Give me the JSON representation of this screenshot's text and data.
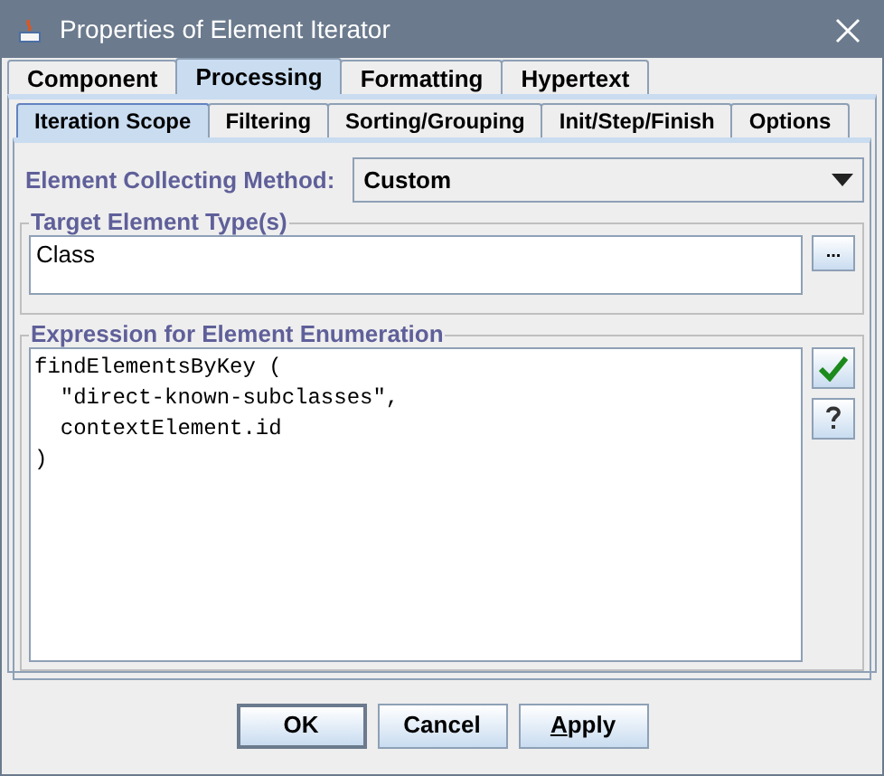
{
  "window": {
    "title": "Properties of Element Iterator"
  },
  "tabs": [
    {
      "label": "Component",
      "selected": false
    },
    {
      "label": "Processing",
      "selected": true
    },
    {
      "label": "Formatting",
      "selected": false
    },
    {
      "label": "Hypertext",
      "selected": false
    }
  ],
  "subtabs": [
    {
      "label": "Iteration Scope",
      "selected": true
    },
    {
      "label": "Filtering",
      "selected": false
    },
    {
      "label": "Sorting/Grouping",
      "selected": false
    },
    {
      "label": "Init/Step/Finish",
      "selected": false
    },
    {
      "label": "Options",
      "selected": false
    }
  ],
  "collecting_method": {
    "label": "Element Collecting Method:",
    "value": "Custom"
  },
  "target_types": {
    "title": "Target Element Type(s)",
    "value": "Class",
    "browse_button": "..."
  },
  "expression": {
    "title": "Expression for Element Enumeration",
    "lines": [
      "findElementsByKey (",
      "  \"direct-known-subclasses\",",
      "  contextElement.id",
      ")"
    ]
  },
  "buttons": [
    {
      "label": "OK",
      "default": true,
      "first_letter_underlined": false
    },
    {
      "label": "Cancel",
      "default": false,
      "first_letter_underlined": false
    },
    {
      "label": "Apply",
      "default": false,
      "first_letter_underlined": true
    }
  ]
}
